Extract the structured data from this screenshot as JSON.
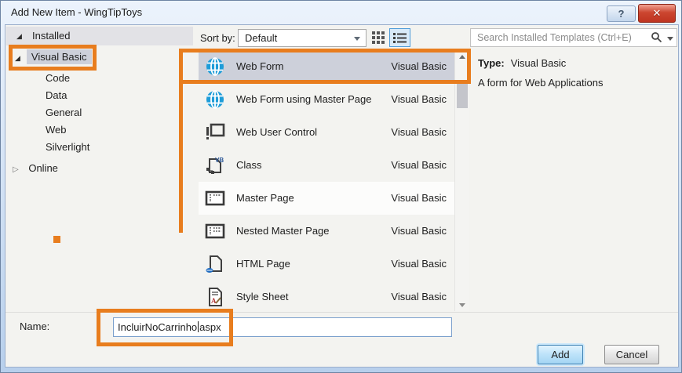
{
  "window": {
    "title": "Add New Item - WingTipToys",
    "help_glyph": "?",
    "close_glyph": "✕"
  },
  "tree": {
    "installed_label": "Installed",
    "visual_basic": {
      "label": "Visual Basic",
      "children": [
        "Code",
        "Data",
        "General",
        "Web",
        "Silverlight"
      ]
    },
    "online_label": "Online"
  },
  "sort_bar": {
    "label": "Sort by:",
    "selected": "Default"
  },
  "search": {
    "placeholder": "Search Installed Templates (Ctrl+E)"
  },
  "templates": {
    "vb_badge": "VB",
    "items": [
      {
        "name": "Web Form",
        "type": "Visual Basic",
        "icon": "web-form-icon",
        "selected": true
      },
      {
        "name": "Web Form using Master Page",
        "type": "Visual Basic",
        "icon": "web-form-icon",
        "selected": false
      },
      {
        "name": "Web User Control",
        "type": "Visual Basic",
        "icon": "web-user-control-icon",
        "selected": false
      },
      {
        "name": "Class",
        "type": "Visual Basic",
        "icon": "vb-class-icon",
        "selected": false
      },
      {
        "name": "Master Page",
        "type": "Visual Basic",
        "icon": "master-page-icon",
        "selected": false
      },
      {
        "name": "Nested Master Page",
        "type": "Visual Basic",
        "icon": "nested-master-page-icon",
        "selected": false
      },
      {
        "name": "HTML Page",
        "type": "Visual Basic",
        "icon": "html-page-icon",
        "selected": false
      },
      {
        "name": "Style Sheet",
        "type": "Visual Basic",
        "icon": "style-sheet-icon",
        "selected": false
      }
    ]
  },
  "details": {
    "type_label": "Type:",
    "type_value": "Visual Basic",
    "description": "A form for Web Applications"
  },
  "footer": {
    "name_label": "Name:",
    "name_value_before_caret": "IncluirNoCarrinho",
    "name_value_after_caret": "aspx",
    "add_label": "Add",
    "cancel_label": "Cancel"
  },
  "colors": {
    "annotation_orange": "#e87d1e",
    "selection_gray": "#cdd0da",
    "globe_blue": "#1e9cd8",
    "close_red": "#c63b26"
  }
}
